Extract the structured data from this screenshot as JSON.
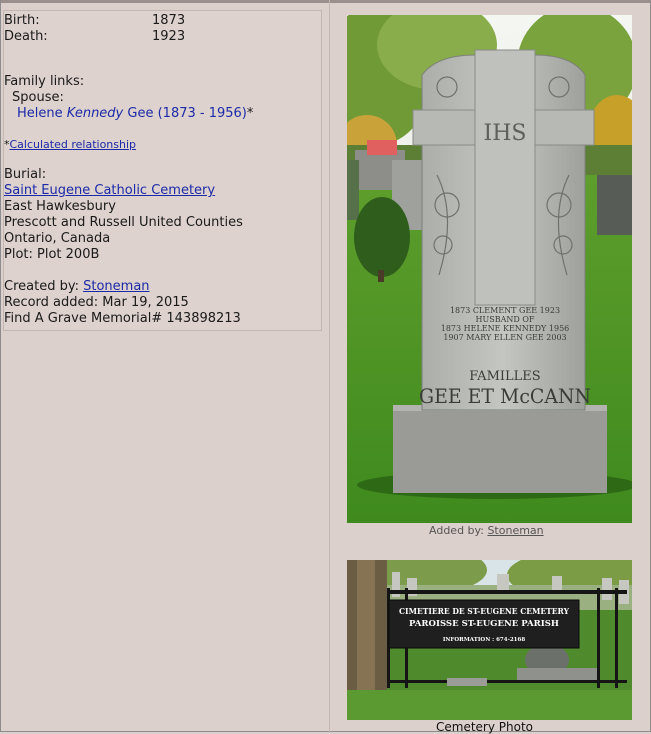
{
  "vitals": {
    "birth_label": "Birth:",
    "birth_value": "1873",
    "death_label": "Death:",
    "death_value": "1923"
  },
  "family": {
    "heading": "Family links:",
    "spouse_label": "Spouse:",
    "spouse_first": "Helene",
    "spouse_maiden": "Kennedy",
    "spouse_last": "Gee",
    "spouse_years": "(1873 - 1956)",
    "spouse_marker": "*",
    "calc_asterisk": "*",
    "calc_link": "Calculated relationship"
  },
  "burial": {
    "heading": "Burial:",
    "cemetery_link": "Saint Eugene Catholic Cemetery",
    "town": "East Hawkesbury",
    "county": "Prescott and Russell United Counties",
    "region": "Ontario, Canada",
    "plot": "Plot: Plot 200B"
  },
  "record": {
    "created_label": "Created by:",
    "created_by": "Stoneman",
    "added": "Record added: Mar 19, 2015",
    "memorial": "Find A Grave Memorial# 143898213"
  },
  "photos": {
    "headstone": {
      "added_label": "Added by:",
      "added_by": "Stoneman",
      "inscription_ihs": "IHS",
      "inscription_lines": [
        "1873   CLEMENT GEE   1923",
        "HUSBAND OF",
        "1873   HELENE KENNEDY   1956",
        "1907   MARY ELLEN GEE   2003"
      ],
      "family_word": "FAMILLES",
      "family_names": "GEE ET McCANN"
    },
    "cemetery": {
      "caption": "Cemetery Photo",
      "sign_line1": "CIMETIERE DE ST-EUGENE CEMETERY",
      "sign_line2": "PAROISSE ST-EUGENE PARISH",
      "sign_line3": "INFORMATION : 674-2168"
    }
  },
  "colors": {
    "background": "#dcd0cc",
    "link": "#1c2aa8"
  }
}
